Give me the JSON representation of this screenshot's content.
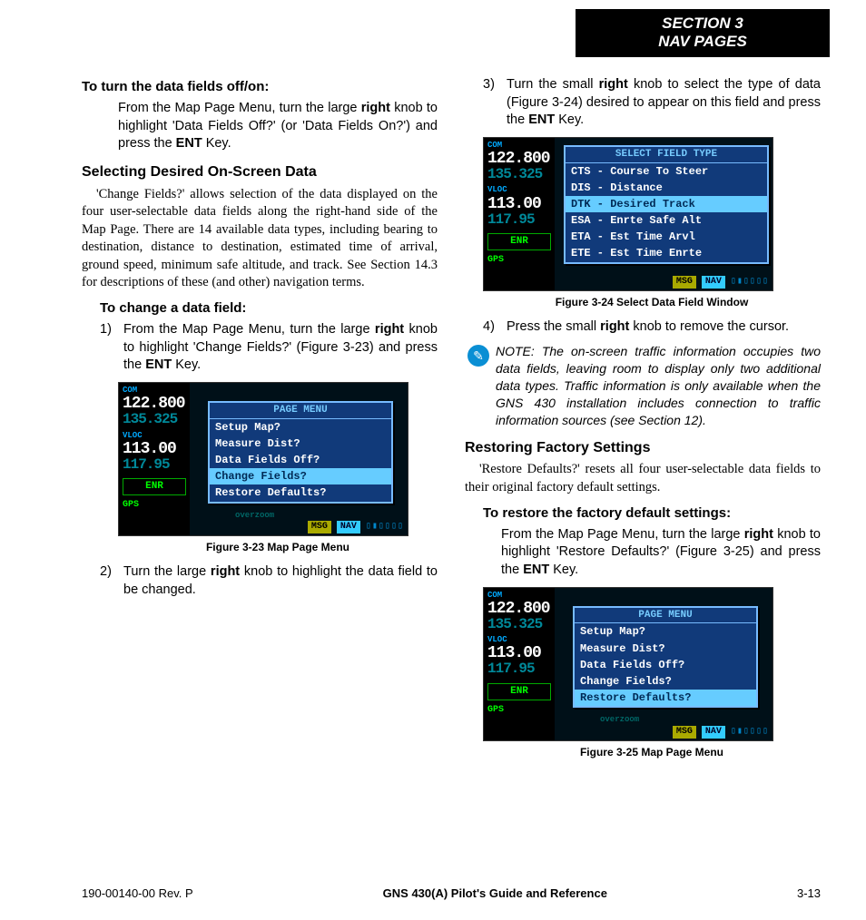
{
  "header": {
    "line1": "SECTION 3",
    "line2": "NAV PAGES"
  },
  "col1": {
    "h1": "To turn the data fields off/on:",
    "p1a": "From the Map Page Menu, turn the large ",
    "p1b": "right",
    "p1c": " knob to highlight 'Data Fields Off?' (or 'Data Fields On?') and press the ",
    "p1d": "ENT",
    "p1e": " Key.",
    "h2": "Selecting Desired On-Screen Data",
    "p2": "'Change Fields?' allows selection of the data displayed on the four user-selectable data fields along the right-hand side of the Map Page.  There are 14 available data types, including bearing to destination, distance to destination, estimated time of arrival, ground speed, minimum safe altitude, and track.  See Section 14.3 for descriptions of these (and other) navigation terms.",
    "h3": "To change a data field:",
    "s1n": "1)",
    "s1a": "From the Map Page Menu, turn the large ",
    "s1b": "right",
    "s1c": " knob to highlight 'Change Fields?' (Figure 3-23) and press the ",
    "s1d": "ENT",
    "s1e": " Key.",
    "cap1": "Figure 3-23  Map Page Menu",
    "s2n": "2)",
    "s2a": "Turn the large ",
    "s2b": "right",
    "s2c": " knob to highlight the data field to be changed."
  },
  "col2": {
    "s3n": "3)",
    "s3a": "Turn the small ",
    "s3b": "right",
    "s3c": " knob to select the type of data (Figure 3-24) desired to appear on this field and press the ",
    "s3d": "ENT",
    "s3e": " Key.",
    "cap2": "Figure 3-24  Select Data Field Window",
    "s4n": "4)",
    "s4a": "Press the small ",
    "s4b": "right",
    "s4c": " knob to remove the cursor.",
    "note": "NOTE:  The on-screen traffic information occupies two data fields, leaving room to display only two additional data types.  Traffic information is only available when the GNS 430 installation includes connection to traffic information sources (see Section 12).",
    "h4": "Restoring Factory Settings",
    "p4": "'Restore Defaults?' resets all four user-selectable data fields to their original factory default settings.",
    "h5": "To restore the factory default settings:",
    "p5a": "From the Map Page Menu, turn the large ",
    "p5b": "right",
    "p5c": " knob to highlight 'Restore Defaults?' (Figure 3-25) and press the ",
    "p5d": "ENT",
    "p5e": " Key.",
    "cap3": "Figure 3-25  Map Page Menu"
  },
  "gns": {
    "com_lbl": "COM",
    "com_active": "122.800",
    "com_standby": "135.325",
    "vloc_lbl": "VLOC",
    "vloc_active": "113.00",
    "vloc_standby": "117.95",
    "enr": "ENR",
    "gps": "GPS",
    "msg": "MSG",
    "nav": "NAV",
    "page_menu_title": "PAGE MENU",
    "page_menu_items": [
      "Setup Map?",
      "Measure Dist?",
      "Data Fields Off?",
      "Change Fields?",
      "Restore Defaults?"
    ],
    "select_title": "SELECT FIELD TYPE",
    "select_items": [
      "CTS  - Course To Steer",
      "DIS  - Distance",
      "DTK  - Desired Track",
      "ESA  - Enrte Safe Alt",
      "ETA  - Est Time Arvl",
      "ETE  - Est Time Enrte"
    ],
    "overzoom": "overzoom"
  },
  "footer": {
    "left": "190-00140-00  Rev. P",
    "center": "GNS 430(A) Pilot's Guide and Reference",
    "right": "3-13"
  }
}
